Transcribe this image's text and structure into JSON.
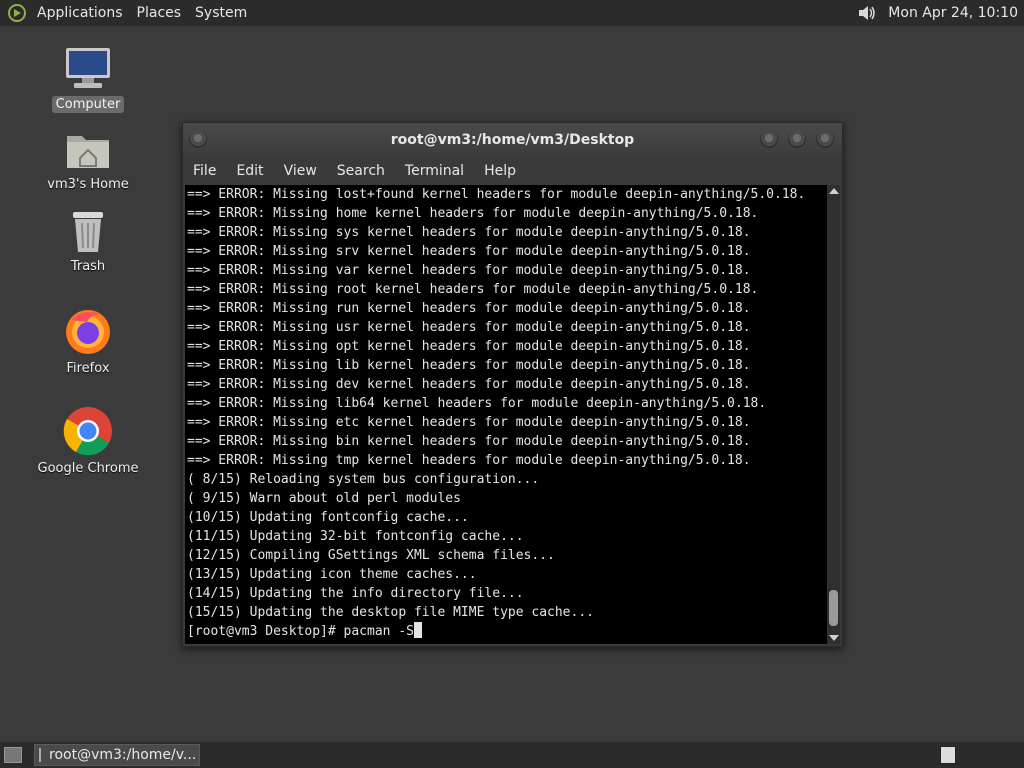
{
  "top_panel": {
    "menus": [
      "Applications",
      "Places",
      "System"
    ],
    "clock": "Mon Apr 24, 10:10"
  },
  "desktop_icons": [
    {
      "label": "Computer",
      "icon": "computer-icon"
    },
    {
      "label": "vm3's Home",
      "icon": "home-folder-icon"
    },
    {
      "label": "Trash",
      "icon": "trash-icon"
    },
    {
      "label": "Firefox",
      "icon": "firefox-icon"
    },
    {
      "label": "Google Chrome",
      "icon": "chrome-icon"
    }
  ],
  "terminal_window": {
    "title": "root@vm3:/home/vm3/Desktop",
    "menu": [
      "File",
      "Edit",
      "View",
      "Search",
      "Terminal",
      "Help"
    ],
    "lines": [
      "==> ERROR: Missing lost+found kernel headers for module deepin-anything/5.0.18.",
      "==> ERROR: Missing home kernel headers for module deepin-anything/5.0.18.",
      "==> ERROR: Missing sys kernel headers for module deepin-anything/5.0.18.",
      "==> ERROR: Missing srv kernel headers for module deepin-anything/5.0.18.",
      "==> ERROR: Missing var kernel headers for module deepin-anything/5.0.18.",
      "==> ERROR: Missing root kernel headers for module deepin-anything/5.0.18.",
      "==> ERROR: Missing run kernel headers for module deepin-anything/5.0.18.",
      "==> ERROR: Missing usr kernel headers for module deepin-anything/5.0.18.",
      "==> ERROR: Missing opt kernel headers for module deepin-anything/5.0.18.",
      "==> ERROR: Missing lib kernel headers for module deepin-anything/5.0.18.",
      "==> ERROR: Missing dev kernel headers for module deepin-anything/5.0.18.",
      "==> ERROR: Missing lib64 kernel headers for module deepin-anything/5.0.18.",
      "==> ERROR: Missing etc kernel headers for module deepin-anything/5.0.18.",
      "==> ERROR: Missing bin kernel headers for module deepin-anything/5.0.18.",
      "==> ERROR: Missing tmp kernel headers for module deepin-anything/5.0.18.",
      "( 8/15) Reloading system bus configuration...",
      "( 9/15) Warn about old perl modules",
      "(10/15) Updating fontconfig cache...",
      "(11/15) Updating 32-bit fontconfig cache...",
      "(12/15) Compiling GSettings XML schema files...",
      "(13/15) Updating icon theme caches...",
      "(14/15) Updating the info directory file...",
      "(15/15) Updating the desktop file MIME type cache..."
    ],
    "prompt": "[root@vm3 Desktop]# pacman -S"
  },
  "bottom_panel": {
    "task_label": "root@vm3:/home/v..."
  }
}
